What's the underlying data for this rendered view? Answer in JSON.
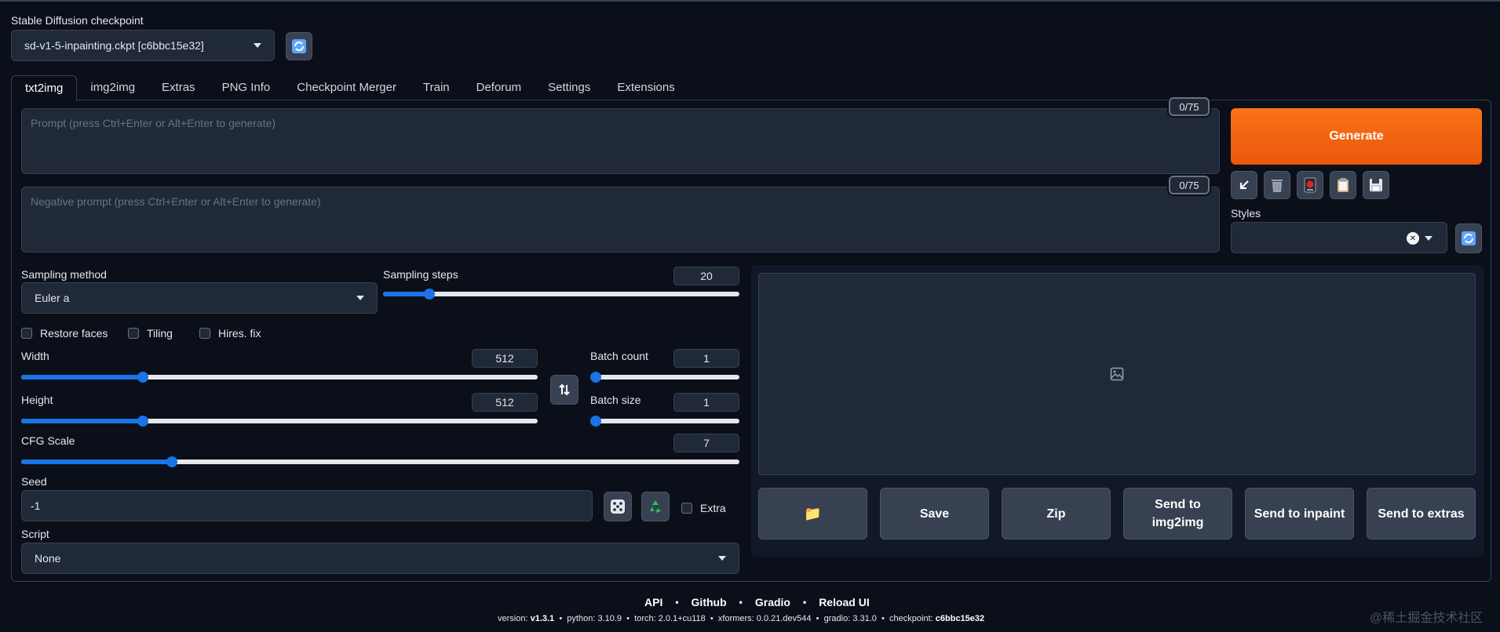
{
  "checkpoint": {
    "label": "Stable Diffusion checkpoint",
    "value": "sd-v1-5-inpainting.ckpt [c6bbc15e32]"
  },
  "tabs": [
    "txt2img",
    "img2img",
    "Extras",
    "PNG Info",
    "Checkpoint Merger",
    "Train",
    "Deforum",
    "Settings",
    "Extensions"
  ],
  "prompt": {
    "placeholder": "Prompt (press Ctrl+Enter or Alt+Enter to generate)",
    "counter": "0/75"
  },
  "negative_prompt": {
    "placeholder": "Negative prompt (press Ctrl+Enter or Alt+Enter to generate)",
    "counter": "0/75"
  },
  "generate_label": "Generate",
  "styles": {
    "label": "Styles",
    "clear_symbol": "✕"
  },
  "sampling": {
    "method_label": "Sampling method",
    "method_value": "Euler a",
    "steps_label": "Sampling steps",
    "steps_value": "20",
    "steps_fraction": 0.13
  },
  "checkboxes": {
    "restore_faces": "Restore faces",
    "tiling": "Tiling",
    "hires_fix": "Hires. fix"
  },
  "width": {
    "label": "Width",
    "value": "512",
    "fraction": 0.235
  },
  "height": {
    "label": "Height",
    "value": "512",
    "fraction": 0.235
  },
  "batch_count": {
    "label": "Batch count",
    "value": "1",
    "fraction": 0.0
  },
  "batch_size": {
    "label": "Batch size",
    "value": "1",
    "fraction": 0.0
  },
  "cfg_scale": {
    "label": "CFG Scale",
    "value": "7",
    "fraction": 0.21
  },
  "seed": {
    "label": "Seed",
    "value": "-1",
    "extra_label": "Extra"
  },
  "script": {
    "label": "Script",
    "value": "None"
  },
  "output_buttons": {
    "folder": "📁",
    "save": "Save",
    "zip": "Zip",
    "send_img2img": "Send to img2img",
    "send_inpaint": "Send to inpaint",
    "send_extras": "Send to extras"
  },
  "footer": {
    "links": [
      "API",
      "Github",
      "Gradio",
      "Reload UI"
    ],
    "separator": "•",
    "version_label": "version:",
    "version": "v1.3.1",
    "python_label": "python:",
    "python": "3.10.9",
    "torch_label": "torch:",
    "torch": "2.0.1+cu118",
    "xformers_label": "xformers:",
    "xformers": "0.0.21.dev544",
    "gradio_label": "gradio:",
    "gradio": "3.31.0",
    "checkpoint_label": "checkpoint:",
    "checkpoint": "c6bbc15e32"
  },
  "watermark": "@稀土掘金技术社区",
  "colors": {
    "background": "#0b0f19",
    "accent": "#ea580c",
    "slider": "#1a73e8"
  },
  "icons": {
    "refresh": "refresh-icon",
    "paste_arrow": "arrow-down-left-icon",
    "trash": "trash-icon",
    "red_marker": "red-card-icon",
    "clipboard": "clipboard-icon",
    "floppy": "floppy-disk-icon",
    "swap": "swap-icon",
    "dice": "dice-icon",
    "recycle": "recycle-icon",
    "image_placeholder": "image-icon",
    "folder": "folder-icon"
  }
}
